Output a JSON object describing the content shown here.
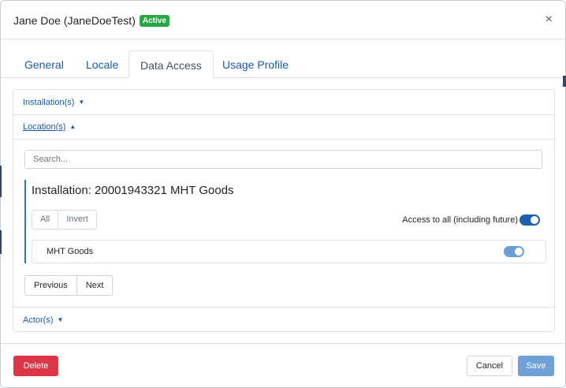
{
  "dialog": {
    "title": "Jane Doe (JaneDoeTest)",
    "status_badge": "Active",
    "close_glyph": "×"
  },
  "tabs": [
    {
      "label": "General",
      "active": false
    },
    {
      "label": "Locale",
      "active": false
    },
    {
      "label": "Data Access",
      "active": true
    },
    {
      "label": "Usage Profile",
      "active": false
    }
  ],
  "sections": {
    "installations": {
      "label": "Installation(s)",
      "caret": "▼",
      "expanded": false
    },
    "locations": {
      "label": "Location(s)",
      "caret": "▲",
      "expanded": true
    },
    "actors": {
      "label": "Actor(s)",
      "caret": "▼",
      "expanded": false
    }
  },
  "search": {
    "placeholder": "Search...",
    "value": ""
  },
  "installation": {
    "title": "Installation: 20001943321 MHT Goods",
    "select_all_label": "All",
    "invert_label": "Invert",
    "access_all_label": "Access to all (including future)",
    "access_all_on": true,
    "items": [
      {
        "name": "MHT Goods",
        "enabled": true
      }
    ]
  },
  "pager": {
    "previous_label": "Previous",
    "next_label": "Next"
  },
  "footer": {
    "delete_label": "Delete",
    "cancel_label": "Cancel",
    "save_label": "Save"
  },
  "colors": {
    "link": "#1b5aa6",
    "active_badge": "#28a745",
    "delete": "#dc3545",
    "save_disabled": "#6fa1d8",
    "toggle_on": "#1d5fa8"
  }
}
